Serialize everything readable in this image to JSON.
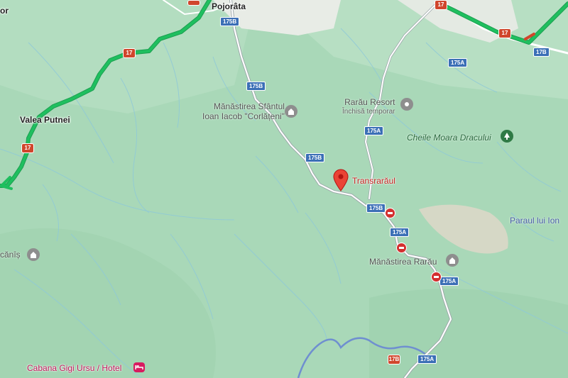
{
  "map": {
    "colors": {
      "terrain": "#a9d8b8",
      "route": "#1fbf5f",
      "road": "#ffffff",
      "shield": "#3b6fb6",
      "pin": "#ea4335"
    },
    "places": {
      "pojorata": "Pojorâta",
      "valea_putnei": "Valea Putnei",
      "manastirea_corlateni_line1": "Mănăstirea Sfântul",
      "manastirea_corlateni_line2": "Ioan Iacob \"Corlățeni\"",
      "rarau_resort": "Rarău Resort",
      "rarau_resort_status": "Închisă temporar",
      "cheile_moara_dracului": "Cheile Moara Dracului",
      "transraraul": "Transrarăul",
      "paraul_lui_ion": "Paraul lui Ion",
      "manastirea_rarau": "Mănăstirea Rarău",
      "cabana_gigi_ursu": "Cabana Gigi Ursu / Hotel",
      "left_cut_label": "cănîș",
      "top_left_cut": "or"
    },
    "shields": {
      "r175b": "175B",
      "r175a": "175A",
      "r17": "17",
      "r17b": "17B"
    },
    "icons": [
      "monastery-icon",
      "resort-icon",
      "park-icon",
      "hotel-icon",
      "no-entry-icon",
      "location-pin-icon"
    ]
  }
}
